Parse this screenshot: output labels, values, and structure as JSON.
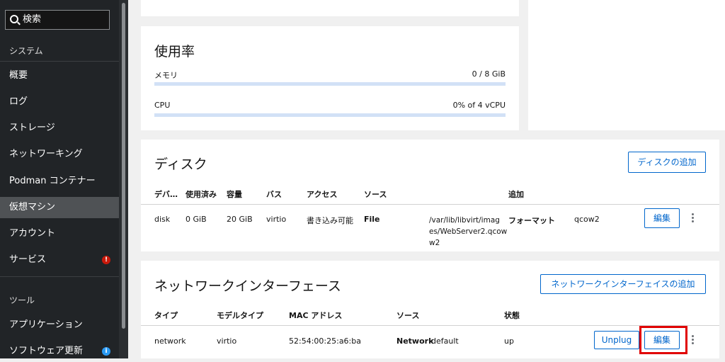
{
  "sidebar": {
    "search_text": "検索",
    "section_system": "システム",
    "items": [
      {
        "label": "概要"
      },
      {
        "label": "ログ"
      },
      {
        "label": "ストレージ"
      },
      {
        "label": "ネットワーキング"
      },
      {
        "label": "Podman コンテナー"
      },
      {
        "label": "仮想マシン"
      },
      {
        "label": "アカウント"
      },
      {
        "label": "サービス"
      }
    ],
    "section_tools": "ツール",
    "tools": [
      {
        "label": "アプリケーション"
      },
      {
        "label": "ソフトウェア更新"
      }
    ],
    "badges": {
      "services": "!",
      "updates": "i"
    },
    "colors": {
      "services_badge": "#c9190b",
      "updates_badge": "#2b9af3"
    }
  },
  "usage": {
    "title": "使用率",
    "memory_label": "メモリ",
    "memory_value": "0 / 8 GiB",
    "memory_fraction": 0,
    "cpu_label": "CPU",
    "cpu_value": "0% of 4 vCPU",
    "cpu_fraction": 0
  },
  "disks": {
    "title": "ディスク",
    "add_button": "ディスクの追加",
    "headers": [
      "デバ…",
      "使用済み",
      "容量",
      "バス",
      "アクセス",
      "ソース",
      "追加"
    ],
    "row": {
      "device": "disk",
      "used": "0 GiB",
      "capacity": "20 GiB",
      "bus": "virtio",
      "access": "書き込み可能",
      "source_type": "File",
      "source_path_lines": [
        "/var/lib/libvirt/imag",
        "es/WebServer2.qcow",
        "w2"
      ],
      "format_label": "フォーマット",
      "format_value": "qcow2",
      "edit_button": "編集"
    }
  },
  "network": {
    "title": "ネットワークインターフェース",
    "add_button": "ネットワークインターフェイスの追加",
    "headers": [
      "タイプ",
      "モデルタイプ",
      "MAC アドレス",
      "ソース",
      "状態"
    ],
    "row": {
      "type": "network",
      "model": "virtio",
      "mac": "52:54:00:25:a6:ba",
      "source_type": "Network",
      "source_value": "default",
      "state": "up",
      "unplug_button": "Unplug",
      "edit_button": "編集"
    }
  },
  "colors": {
    "accent": "#0066cc",
    "highlight": "#e00000"
  }
}
